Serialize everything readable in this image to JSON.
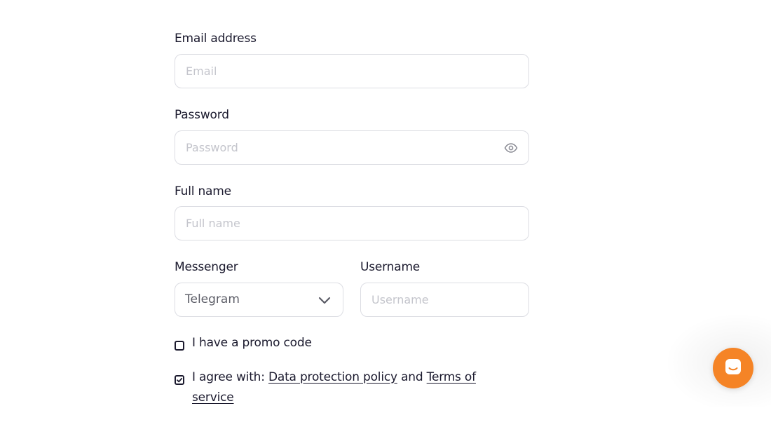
{
  "form": {
    "email": {
      "label": "Email address",
      "placeholder": "Email"
    },
    "password": {
      "label": "Password",
      "placeholder": "Password",
      "toggle_icon": "eye-icon"
    },
    "full_name": {
      "label": "Full name",
      "placeholder": "Full name"
    },
    "messenger": {
      "label": "Messenger",
      "selected": "Telegram",
      "icon": "chevron-down-icon"
    },
    "username": {
      "label": "Username",
      "placeholder": "Username"
    },
    "promo": {
      "label": "I have a promo code",
      "checked": false
    },
    "agree": {
      "prefix": "I agree with: ",
      "policy_link": "Data protection policy",
      "joiner": " and ",
      "terms_link": "Terms of service",
      "checked": true
    }
  },
  "chat_widget": {
    "icon": "chat-icon",
    "color": "#f58426"
  }
}
